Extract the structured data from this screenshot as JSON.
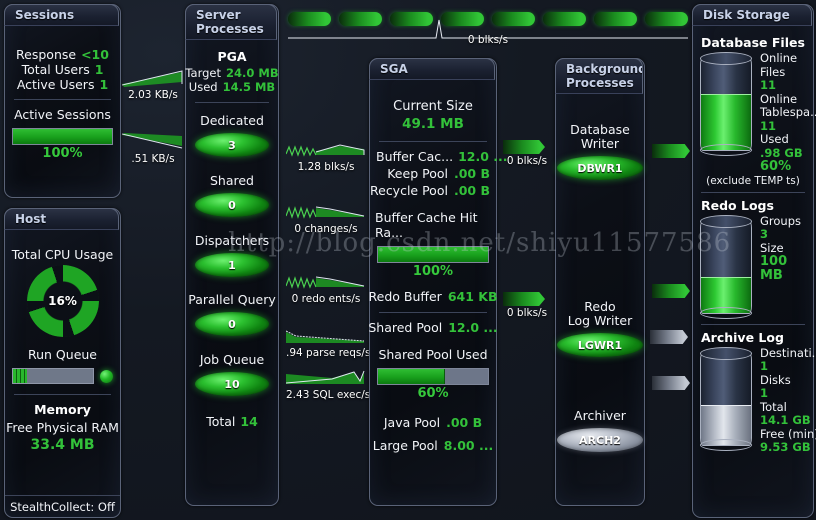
{
  "watermark": "http://blog.csdn.net/shiyu11577586",
  "sessions": {
    "title": "Sessions",
    "rows": [
      {
        "label": "Response",
        "value": "<10"
      },
      {
        "label": "Total Users",
        "value": "1"
      },
      {
        "label": "Active Users",
        "value": "1"
      }
    ],
    "gauge_label": "Active Sessions",
    "gauge_pct_text": "100%",
    "gauge_pct": 100
  },
  "host": {
    "title": "Host",
    "cpu_label": "Total CPU Usage",
    "cpu_pct_text": "16%",
    "run_queue_label": "Run Queue",
    "memory_title": "Memory",
    "memory_label": "Free Physical RAM",
    "memory_value": "33.4 MB",
    "stealth": "StealthCollect: Off"
  },
  "server_processes": {
    "title_line1": "Server",
    "title_line2": "Processes",
    "pga_title": "PGA",
    "pga_rows": [
      {
        "label": "Target",
        "value": "24.0 MB"
      },
      {
        "label": "Used",
        "value": "14.5 MB"
      }
    ],
    "leds": [
      {
        "label": "Dedicated",
        "value": "3"
      },
      {
        "label": "Shared",
        "value": "0"
      },
      {
        "label": "Dispatchers",
        "value": "1"
      },
      {
        "label": "Parallel Query",
        "value": "0"
      },
      {
        "label": "Job Queue",
        "value": "10"
      }
    ],
    "total_label": "Total",
    "total_value": "14"
  },
  "sga": {
    "title": "SGA",
    "current_size_label": "Current Size",
    "current_size_value": "49.1 MB",
    "rows_top": [
      {
        "label": "Buffer Cac...",
        "value": "12.0 ..."
      },
      {
        "label": "Keep Pool",
        "value": ".00 B"
      },
      {
        "label": "Recycle Pool",
        "value": ".00 B"
      }
    ],
    "hit_ratio_label": "Buffer Cache Hit Ra...",
    "hit_ratio_pct_text": "100%",
    "hit_ratio_pct": 100,
    "redo_buffer_label": "Redo Buffer",
    "redo_buffer_value": "641 KB",
    "shared_pool_label": "Shared Pool",
    "shared_pool_value": "12.0 ...",
    "shared_used_label": "Shared Pool Used",
    "shared_used_pct_text": "60%",
    "shared_used_pct": 60,
    "rows_bottom": [
      {
        "label": "Java Pool",
        "value": ".00 B"
      },
      {
        "label": "Large Pool",
        "value": "8.00 ..."
      }
    ]
  },
  "background_processes": {
    "title_line1": "Background",
    "title_line2": "Processes",
    "items": [
      {
        "label_line1": "Database",
        "label_line2": "Writer",
        "pill": "DBWR1",
        "state": "green"
      },
      {
        "label_line1": "Redo",
        "label_line2": "Log Writer",
        "pill": "LGWR1",
        "state": "green"
      },
      {
        "label_line1": "Archiver",
        "label_line2": "",
        "pill": "ARCH2",
        "state": "grey"
      }
    ]
  },
  "disk_storage": {
    "title": "Disk Storage",
    "sections": [
      {
        "heading": "Database Files",
        "fill_pct": 60,
        "fill_color": "green",
        "rows": [
          {
            "label": "Online Files",
            "value": "11"
          },
          {
            "label": "Online Tablespa...",
            "value": "11"
          },
          {
            "label": "Used",
            "value": ".98 GB"
          },
          {
            "label": "",
            "value": "60%"
          }
        ],
        "note": "(exclude TEMP ts)"
      },
      {
        "heading": "Redo Logs",
        "fill_pct": 38,
        "fill_color": "green",
        "rows": [
          {
            "label": "Groups",
            "value": "3"
          },
          {
            "label": "Size",
            "value": "100 MB"
          }
        ],
        "note": ""
      },
      {
        "heading": "Archive Log",
        "fill_pct": 42,
        "fill_color": "grey",
        "rows": [
          {
            "label": "Destinati...",
            "value": "1"
          },
          {
            "label": "Disks",
            "value": "1"
          },
          {
            "label": "Total",
            "value": "14.1 GB"
          },
          {
            "label": "Free (min)",
            "value": "9.53 GB"
          }
        ],
        "note": ""
      }
    ]
  },
  "flows": {
    "top_label": "0 blks/s",
    "sessions_to_server_1": "2.03 KB/s",
    "sessions_to_server_2": ".51 KB/s",
    "server_to_sga_1": "1.28 blks/s",
    "server_to_sga_2": "0 changes/s",
    "server_to_sga_3": "0 redo ents/s",
    "server_to_sga_4": ".94 parse reqs/s",
    "server_to_sga_5": "2.43 SQL exec/s",
    "sga_to_bg_1": "0 blks/s",
    "sga_to_bg_2": "0 blks/s"
  },
  "colors": {
    "accent_green": "#33c13a",
    "panel_border": "#5a6378",
    "text": "#ffffff"
  }
}
